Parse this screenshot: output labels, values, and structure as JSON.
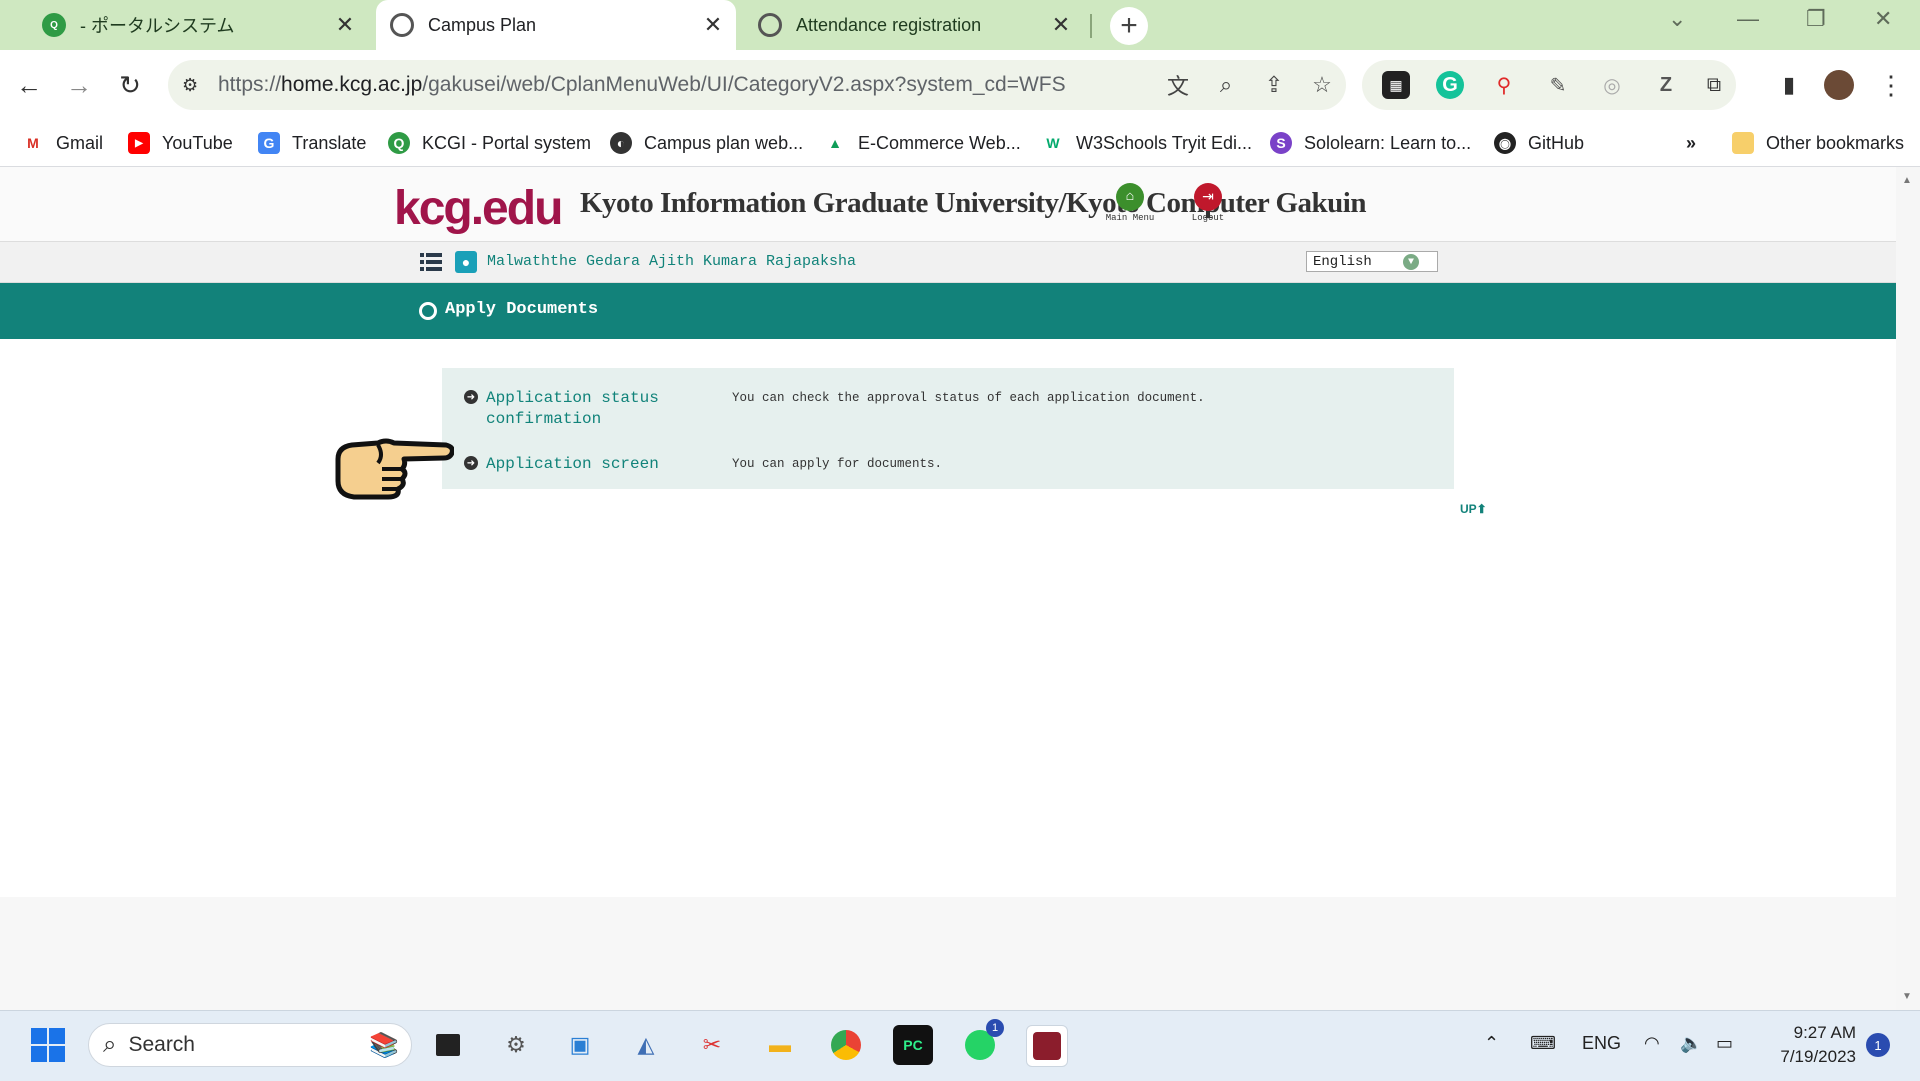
{
  "browser": {
    "tabs": [
      {
        "label": "- ポータルシステム",
        "icon": "kcgi-favicon-icon",
        "active": false
      },
      {
        "label": "Campus Plan",
        "icon": "globe-icon",
        "active": true
      },
      {
        "label": "Attendance registration",
        "icon": "globe-icon",
        "active": false
      }
    ],
    "address": {
      "prefix": "https://",
      "host": "home.kcg.ac.jp",
      "path": "/gakusei/web/CplanMenuWeb/UI/CategoryV2.aspx?system_cd=WFS"
    },
    "bookmarks": [
      {
        "label": "Gmail",
        "icon": "gmail-icon"
      },
      {
        "label": "YouTube",
        "icon": "youtube-icon"
      },
      {
        "label": "Translate",
        "icon": "translate-icon"
      },
      {
        "label": "KCGI - Portal system",
        "icon": "kcgi-icon"
      },
      {
        "label": "Campus plan web...",
        "icon": "globe-icon"
      },
      {
        "label": "E-Commerce Web...",
        "icon": "drive-icon"
      },
      {
        "label": "W3Schools Tryit Edi...",
        "icon": "w3schools-icon"
      },
      {
        "label": "Sololearn: Learn to...",
        "icon": "sololearn-icon"
      },
      {
        "label": "GitHub",
        "icon": "github-icon"
      }
    ],
    "more_bookmarks": "»",
    "other_bookmarks": "Other bookmarks"
  },
  "site": {
    "logo": "kcg.edu",
    "title": "Kyoto Information Graduate University/Kyoto Computer Gakuin",
    "main_menu_label": "Main Menu",
    "logout_label": "Logout",
    "user_name": "Malwaththe Gedara Ajith Kumara Rajapaksha",
    "language": "English",
    "section_title": "Apply Documents",
    "menu_items": [
      {
        "link": "Application status confirmation",
        "description": "You can check the approval status of each application document."
      },
      {
        "link": "Application screen",
        "description": "You can apply for documents."
      }
    ],
    "up_label": "UP"
  },
  "taskbar": {
    "search_placeholder": "Search",
    "language": "ENG",
    "time": "9:27 AM",
    "date": "7/19/2023",
    "notification_count": "1",
    "whatsapp_badge": "1"
  },
  "colors": {
    "teal": "#12827a",
    "logo": "#a0154a",
    "tabstrip": "#cfe8c1"
  }
}
